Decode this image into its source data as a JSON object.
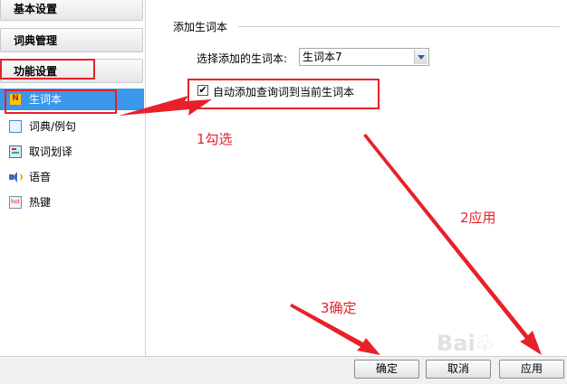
{
  "sidebar": {
    "categories": [
      {
        "label": "基本设置"
      },
      {
        "label": "词典管理"
      },
      {
        "label": "功能设置"
      }
    ],
    "items": [
      {
        "label": "生词本",
        "icon": "notebook-icon"
      },
      {
        "label": "词典/例句",
        "icon": "dictionary-icon"
      },
      {
        "label": "取词划译",
        "icon": "word-capture-icon"
      },
      {
        "label": "语音",
        "icon": "speaker-icon"
      },
      {
        "label": "热键",
        "icon": "hotkey-icon"
      }
    ]
  },
  "main": {
    "section_title": "添加生词本",
    "select_label": "选择添加的生词本:",
    "select_value": "生词本7",
    "checkbox_label": "自动添加查询词到当前生词本",
    "checkbox_checked": true
  },
  "annotations": {
    "step1": "1勾选",
    "step2": "2应用",
    "step3": "3确定",
    "color": "#e8202a"
  },
  "buttons": {
    "ok": "确定",
    "cancel": "取消",
    "apply": "应用"
  },
  "colors": {
    "selected_bg": "#3b97ea",
    "highlight": "#e8202a"
  }
}
